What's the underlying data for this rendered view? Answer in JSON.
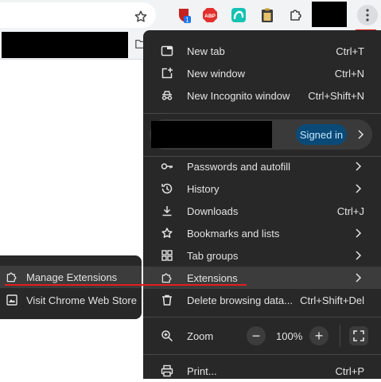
{
  "menu": {
    "items_top": [
      {
        "label": "New tab",
        "shortcut": "Ctrl+T",
        "icon": "new-tab-icon"
      },
      {
        "label": "New window",
        "shortcut": "Ctrl+N",
        "icon": "new-window-icon"
      },
      {
        "label": "New Incognito window",
        "shortcut": "Ctrl+Shift+N",
        "icon": "incognito-icon"
      }
    ],
    "profile": {
      "signed_in_label": "Signed in"
    },
    "items_mid": [
      {
        "label": "Passwords and autofill",
        "icon": "key-icon"
      },
      {
        "label": "History",
        "icon": "history-icon"
      },
      {
        "label": "Downloads",
        "shortcut": "Ctrl+J",
        "icon": "download-icon"
      },
      {
        "label": "Bookmarks and lists",
        "icon": "star-icon"
      },
      {
        "label": "Tab groups",
        "icon": "tab-groups-icon"
      },
      {
        "label": "Extensions",
        "icon": "puzzle-icon"
      },
      {
        "label": "Delete browsing data...",
        "shortcut": "Ctrl+Shift+Del",
        "icon": "trash-icon"
      }
    ],
    "zoom": {
      "label": "Zoom",
      "value": "100%",
      "minus": "−",
      "plus": "+"
    },
    "print": {
      "label": "Print...",
      "shortcut": "Ctrl+P"
    }
  },
  "submenu": {
    "items": [
      {
        "label": "Manage Extensions",
        "icon": "puzzle-icon"
      },
      {
        "label": "Visit Chrome Web Store",
        "icon": "web-store-icon"
      }
    ]
  },
  "toolbar": {
    "extensions": [
      {
        "name": "shield-extension-icon",
        "badge": "1",
        "color": "#c5221f"
      },
      {
        "name": "adblock-plus-icon",
        "text": "ABP",
        "color": "#e1302d"
      },
      {
        "name": "teal-extension-icon",
        "color": "#15c2b4"
      },
      {
        "name": "clipboard-extension-icon",
        "color": "#3c3c3c"
      }
    ]
  },
  "colors": {
    "menu_bg": "#282828",
    "highlight": "#3c3c3c",
    "accent_pill": "#0b4a77",
    "annotation": "#e01f1f"
  }
}
